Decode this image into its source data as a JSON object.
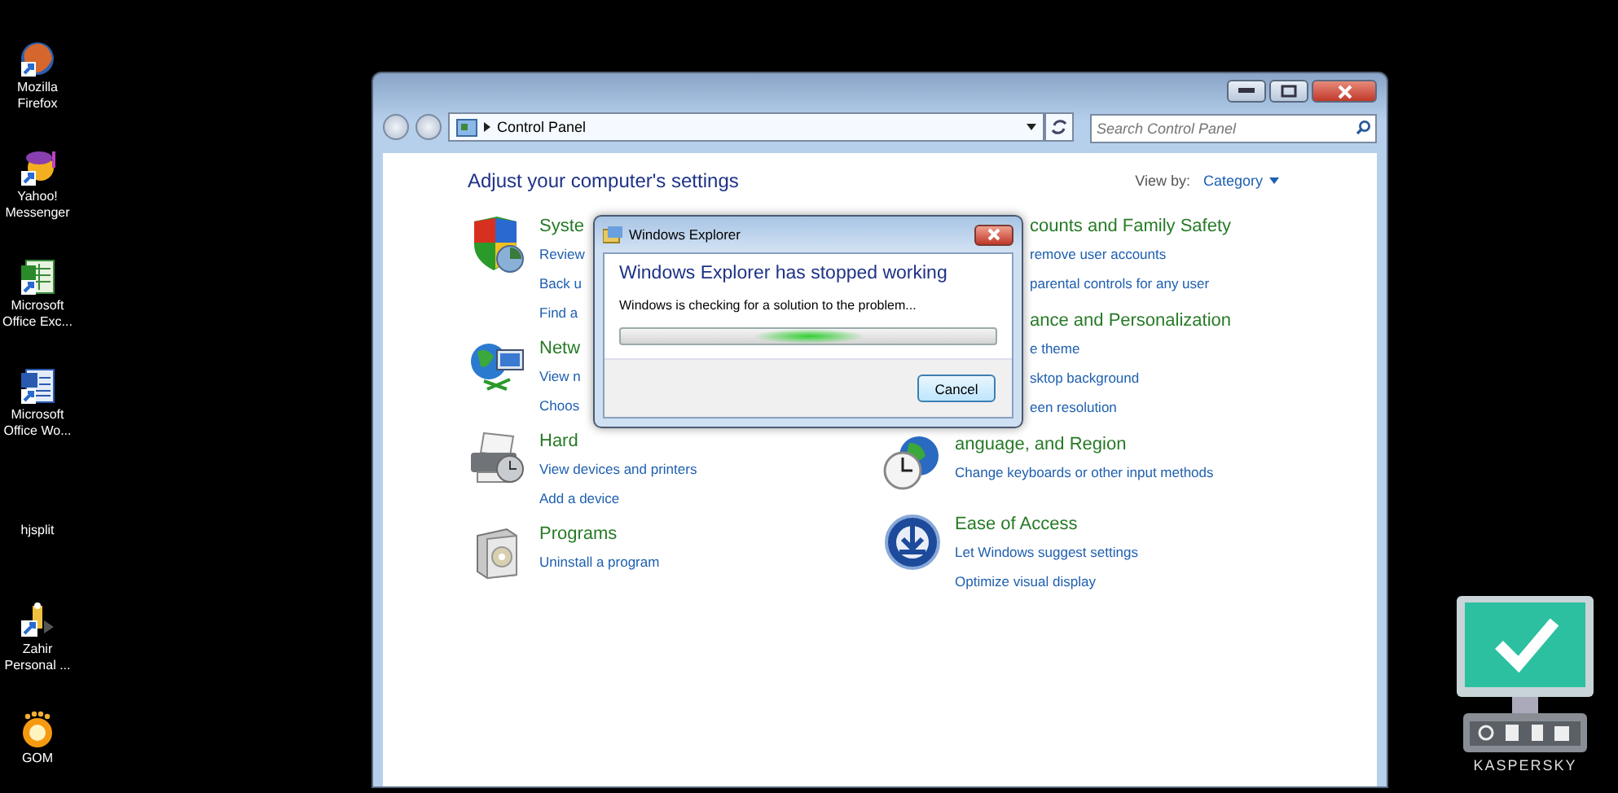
{
  "desktop_icons": [
    {
      "kind": "firefox",
      "label": "Mozilla Firefox"
    },
    {
      "kind": "messenger",
      "label": "Yahoo! Messenger"
    },
    {
      "kind": "excel",
      "label": "Microsoft Office Exc..."
    },
    {
      "kind": "word",
      "label": "Microsoft Office Wo..."
    },
    {
      "kind": "none",
      "label": "hjsplit"
    },
    {
      "kind": "app",
      "label": "Zahir Personal ..."
    },
    {
      "kind": "gom",
      "label": "GOM"
    }
  ],
  "window": {
    "address": "Control Panel",
    "search": {
      "placeholder": "Search Control Panel"
    },
    "heading": "Adjust your computer's settings",
    "view_by": {
      "label": "View by:",
      "value": "Category"
    },
    "left_categories": [
      {
        "kind": "shield",
        "title": "Syste",
        "links": [
          "Review",
          "Back u",
          "Find a"
        ]
      },
      {
        "kind": "network",
        "title": "Netw",
        "links": [
          "View n",
          "Choos"
        ]
      },
      {
        "kind": "printer",
        "title": "Hard",
        "links": [
          "View devices and printers",
          "Add a device"
        ]
      },
      {
        "kind": "programs",
        "title": "Programs",
        "links": [
          "Uninstall a program"
        ]
      }
    ],
    "right_categories": [
      {
        "kind": "covered",
        "title": "counts and Family Safety",
        "links": [
          "remove user accounts",
          "parental controls for any user"
        ]
      },
      {
        "kind": "covered",
        "title": "ance and Personalization",
        "links": [
          "e theme",
          "sktop background",
          "een resolution"
        ]
      },
      {
        "kind": "clock",
        "title": "anguage, and Region",
        "links": [
          "Change keyboards or other input methods"
        ]
      },
      {
        "kind": "access",
        "title": "Ease of Access",
        "links": [
          "Let Windows suggest settings",
          "Optimize visual display"
        ]
      }
    ]
  },
  "dialog": {
    "title": "Windows Explorer",
    "heading": "Windows Explorer has stopped working",
    "message": "Windows is checking for a solution to the problem...",
    "button": "Cancel",
    "progress": {
      "indeterminate": true
    }
  },
  "gadget": {
    "brand": "KASPERSKY"
  }
}
